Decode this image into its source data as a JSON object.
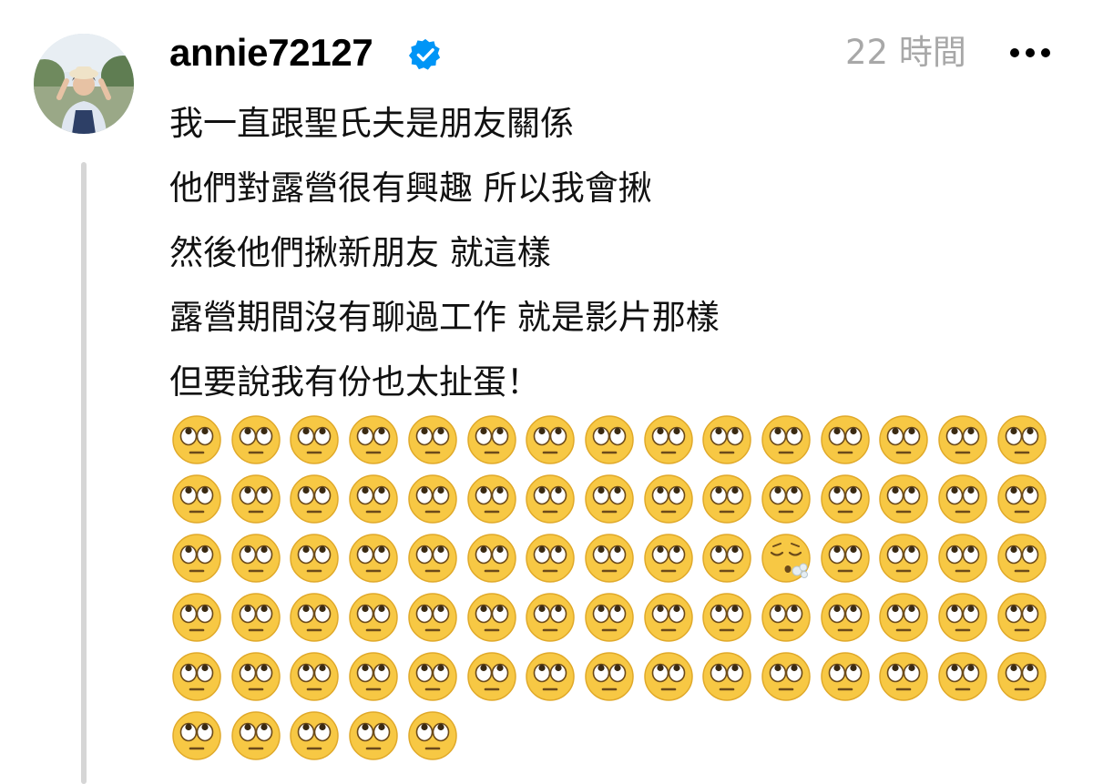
{
  "post": {
    "username": "annie72127",
    "verified_icon": "verified-badge-icon",
    "timestamp": "22 時間",
    "more_icon": "more-horizontal-icon",
    "lines": [
      "我一直跟聖氏夫是朋友關係",
      "他們對露營很有興趣 所以我會揪",
      "然後他們揪新朋友 就這樣",
      "露營期間沒有聊過工作 就是影片那樣",
      "但要說我有份也太扯蛋！"
    ],
    "emoji_rows": [
      [
        "🙄",
        "🙄",
        "🙄",
        "🙄",
        "🙄",
        "🙄",
        "🙄",
        "🙄",
        "🙄",
        "🙄",
        "🙄",
        "🙄",
        "🙄",
        "🙄",
        "🙄"
      ],
      [
        "🙄",
        "🙄",
        "🙄",
        "🙄",
        "🙄",
        "🙄",
        "🙄",
        "🙄",
        "🙄",
        "🙄",
        "🙄",
        "🙄",
        "🙄",
        "🙄",
        "🙄"
      ],
      [
        "🙄",
        "🙄",
        "🙄",
        "🙄",
        "🙄",
        "🙄",
        "🙄",
        "🙄",
        "🙄",
        "🙄",
        "😮‍💨",
        "🙄",
        "🙄",
        "🙄",
        "🙄"
      ],
      [
        "🙄",
        "🙄",
        "🙄",
        "🙄",
        "🙄",
        "🙄",
        "🙄",
        "🙄",
        "🙄",
        "🙄",
        "🙄",
        "🙄",
        "🙄",
        "🙄",
        "🙄"
      ],
      [
        "🙄",
        "🙄",
        "🙄",
        "🙄",
        "🙄",
        "🙄",
        "🙄",
        "🙄",
        "🙄",
        "🙄",
        "🙄",
        "🙄",
        "🙄",
        "🙄",
        "🙄"
      ],
      [
        "🙄",
        "🙄",
        "🙄",
        "🙄",
        "🙄"
      ]
    ]
  },
  "colors": {
    "verified": "#0095f6",
    "timestamp": "#a8a8a8",
    "thread_line": "#d6d6d6",
    "emoji_face": "#f7c844"
  }
}
